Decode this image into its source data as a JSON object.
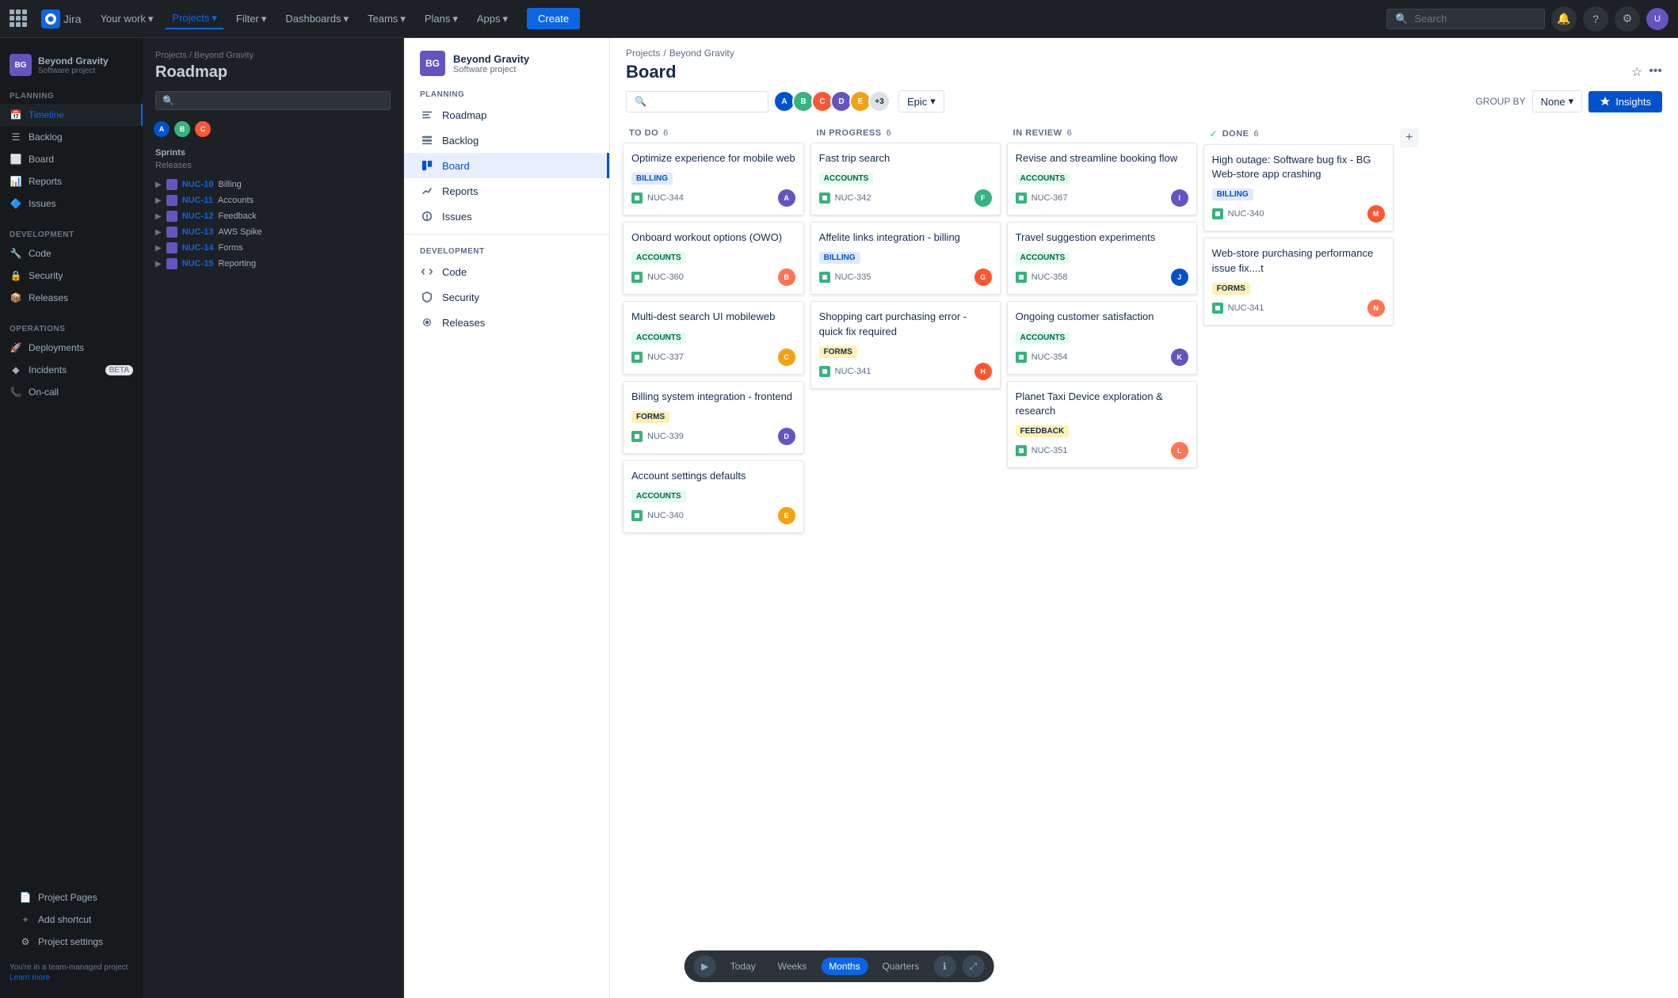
{
  "topnav": {
    "logo_text": "Jira",
    "your_work": "Your work",
    "projects": "Projects",
    "filter": "Filter",
    "dashboards": "Dashboards",
    "teams": "Teams",
    "plans": "Plans",
    "apps": "Apps",
    "create": "Create",
    "search_placeholder": "Search"
  },
  "far_left_sidebar": {
    "project_name": "Beyond Gravity",
    "project_type": "Software project",
    "project_icon": "BG",
    "planning_label": "PLANNING",
    "planning_items": [
      {
        "id": "timeline",
        "label": "Timeline",
        "icon": "📅",
        "active": true
      },
      {
        "id": "backlog",
        "label": "Backlog",
        "icon": "☰"
      },
      {
        "id": "board",
        "label": "Board",
        "icon": "⬜"
      },
      {
        "id": "reports",
        "label": "Reports",
        "icon": "📊"
      },
      {
        "id": "issues",
        "label": "Issues",
        "icon": "🔷"
      }
    ],
    "development_label": "DEVELOPMENT",
    "development_items": [
      {
        "id": "code",
        "label": "Code",
        "icon": "🔧"
      },
      {
        "id": "security",
        "label": "Security",
        "icon": "🔒"
      },
      {
        "id": "releases",
        "label": "Releases",
        "icon": "📦"
      }
    ],
    "operations_label": "OPERATIONS",
    "operations_items": [
      {
        "id": "deployments",
        "label": "Deployments",
        "icon": "🚀"
      },
      {
        "id": "incidents",
        "label": "Incidents",
        "icon": "◆",
        "badge": "BETA"
      },
      {
        "id": "on-call",
        "label": "On-call",
        "icon": "📞"
      }
    ],
    "project_pages": "Project Pages",
    "add_shortcut": "Add shortcut",
    "project_settings": "Project settings",
    "footer_text": "You're in a team-managed project",
    "footer_link": "Learn more"
  },
  "secondary_sidebar": {
    "breadcrumb": "Projects / Beyond Gravity",
    "title": "Roadmap",
    "search_placeholder": "",
    "sprints_label": "Sprints",
    "releases_label": "Releases",
    "releases": [
      {
        "id": "NUC-10",
        "name": "Billing"
      },
      {
        "id": "NUC-11",
        "name": "Accounts"
      },
      {
        "id": "NUC-12",
        "name": "Feedback"
      },
      {
        "id": "NUC-13",
        "name": "AWS Spike"
      },
      {
        "id": "NUC-14",
        "name": "Forms"
      },
      {
        "id": "NUC-15",
        "name": "Reporting"
      }
    ]
  },
  "left_nav_panel": {
    "project_name": "Beyond Gravity",
    "project_type": "Software project",
    "project_icon": "BG",
    "planning_label": "PLANNING",
    "planning_items": [
      {
        "id": "roadmap",
        "label": "Roadmap",
        "icon": "roadmap"
      },
      {
        "id": "backlog",
        "label": "Backlog",
        "icon": "backlog"
      },
      {
        "id": "board",
        "label": "Board",
        "icon": "board",
        "active": true
      },
      {
        "id": "reports",
        "label": "Reports",
        "icon": "reports"
      },
      {
        "id": "issues",
        "label": "Issues",
        "icon": "issues"
      }
    ],
    "development_label": "DEVELOPMENT",
    "development_items": [
      {
        "id": "code",
        "label": "Code",
        "icon": "code"
      },
      {
        "id": "security",
        "label": "Security",
        "icon": "security"
      },
      {
        "id": "releases",
        "label": "Releases",
        "icon": "releases"
      }
    ],
    "project_settings": "Project settings"
  },
  "board": {
    "breadcrumb_projects": "Projects",
    "breadcrumb_separator": "/",
    "breadcrumb_project": "Beyond Gravity",
    "title": "Board",
    "group_by_label": "GROUP BY",
    "group_by_value": "None",
    "insights_label": "Insights",
    "epic_label": "Epic",
    "columns": [
      {
        "id": "todo",
        "title": "TO DO",
        "count": 6,
        "cards": [
          {
            "id": "c1",
            "title": "Optimize experience for mobile web",
            "badge": "BILLING",
            "badge_type": "billing",
            "issue_id": "NUC-344",
            "avatar_color": "#6554c0",
            "avatar_text": "A"
          },
          {
            "id": "c2",
            "title": "Onboard workout options (OWO)",
            "badge": "ACCOUNTS",
            "badge_type": "accounts",
            "issue_id": "NUC-360",
            "avatar_color": "#ff7452",
            "avatar_text": "B"
          },
          {
            "id": "c3",
            "title": "Multi-dest search UI mobileweb",
            "badge": "ACCOUNTS",
            "badge_type": "accounts",
            "issue_id": "NUC-337",
            "avatar_color": "#f4a20f",
            "avatar_text": "C"
          },
          {
            "id": "c4",
            "title": "Billing system integration - frontend",
            "badge": "FORMS",
            "badge_type": "forms",
            "issue_id": "NUC-339",
            "avatar_color": "#6554c0",
            "avatar_text": "D"
          },
          {
            "id": "c5",
            "title": "Account settings defaults",
            "badge": "ACCOUNTS",
            "badge_type": "accounts",
            "issue_id": "NUC-340",
            "avatar_color": "#f4a20f",
            "avatar_text": "E"
          }
        ]
      },
      {
        "id": "inprogress",
        "title": "IN PROGRESS",
        "count": 6,
        "cards": [
          {
            "id": "c6",
            "title": "Fast trip search",
            "badge": "ACCOUNTS",
            "badge_type": "accounts",
            "issue_id": "NUC-342",
            "avatar_color": "#36b37e",
            "avatar_text": "F"
          },
          {
            "id": "c7",
            "title": "Affelite links integration - billing",
            "badge": "BILLING",
            "badge_type": "billing",
            "issue_id": "NUC-335",
            "avatar_color": "#ff5630",
            "avatar_text": "G"
          },
          {
            "id": "c8",
            "title": "Shopping cart purchasing error - quick fix required",
            "badge": "FORMS",
            "badge_type": "forms",
            "issue_id": "NUC-341",
            "avatar_color": "#ff5630",
            "avatar_text": "H"
          }
        ]
      },
      {
        "id": "inreview",
        "title": "IN REVIEW",
        "count": 6,
        "cards": [
          {
            "id": "c9",
            "title": "Revise and streamline booking flow",
            "badge": "ACCOUNTS",
            "badge_type": "accounts",
            "issue_id": "NUC-367",
            "avatar_color": "#6554c0",
            "avatar_text": "I"
          },
          {
            "id": "c10",
            "title": "Travel suggestion experiments",
            "badge": "ACCOUNTS",
            "badge_type": "accounts",
            "issue_id": "NUC-358",
            "avatar_color": "#0052cc",
            "avatar_text": "J"
          },
          {
            "id": "c11",
            "title": "Ongoing customer satisfaction",
            "badge": "ACCOUNTS",
            "badge_type": "accounts",
            "issue_id": "NUC-354",
            "avatar_color": "#6554c0",
            "avatar_text": "K"
          },
          {
            "id": "c12",
            "title": "Planet Taxi Device exploration & research",
            "badge": "FEEDBACK",
            "badge_type": "feedback",
            "issue_id": "NUC-351",
            "avatar_color": "#ff7452",
            "avatar_text": "L"
          }
        ]
      },
      {
        "id": "done",
        "title": "DONE",
        "count": 6,
        "cards": [
          {
            "id": "c13",
            "title": "High outage: Software bug fix - BG Web-store app crashing",
            "badge": "BILLING",
            "badge_type": "billing",
            "issue_id": "NUC-340",
            "avatar_color": "#ff5630",
            "avatar_text": "M"
          },
          {
            "id": "c14",
            "title": "Web-store purchasing performance issue fix....t",
            "badge": "FORMS",
            "badge_type": "forms",
            "issue_id": "NUC-341",
            "avatar_color": "#ff7452",
            "avatar_text": "N"
          }
        ]
      }
    ]
  },
  "roadmap_bottom": {
    "today": "Today",
    "weeks": "Weeks",
    "months": "Months",
    "quarters": "Quarters"
  },
  "avatar_colors": {
    "a1": "#0052cc",
    "a2": "#36b37e",
    "a3": "#ff5630",
    "a4": "#6554c0",
    "a5": "#f4a20f"
  }
}
